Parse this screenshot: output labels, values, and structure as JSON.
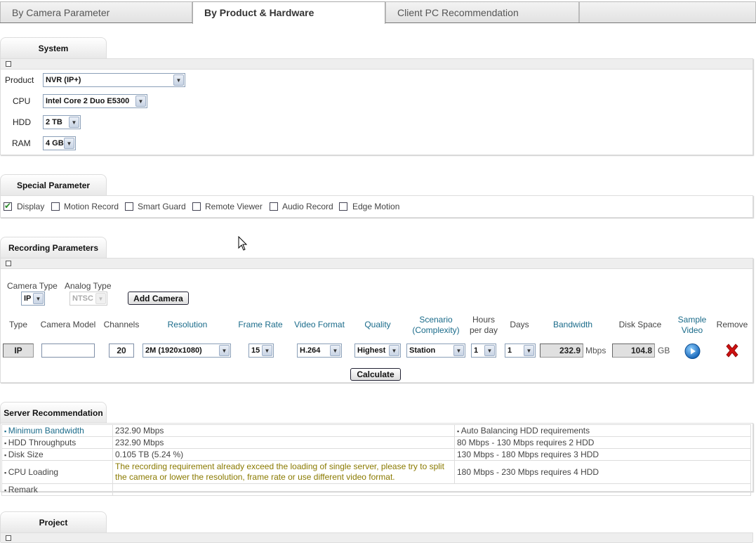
{
  "tabs": [
    "By Camera Parameter",
    "By Product & Hardware",
    "Client PC Recommendation"
  ],
  "system": {
    "title": "System",
    "product_label": "Product",
    "product_value": "NVR (IP+)",
    "cpu_label": "CPU",
    "cpu_value": "Intel Core 2 Duo E5300",
    "hdd_label": "HDD",
    "hdd_value": "2 TB",
    "ram_label": "RAM",
    "ram_value": "4 GB"
  },
  "special": {
    "title": "Special Parameter",
    "options": [
      {
        "label": "Display",
        "checked": true
      },
      {
        "label": "Motion Record",
        "checked": false
      },
      {
        "label": "Smart Guard",
        "checked": false
      },
      {
        "label": "Remote Viewer",
        "checked": false
      },
      {
        "label": "Audio Record",
        "checked": false
      },
      {
        "label": "Edge Motion",
        "checked": false
      }
    ]
  },
  "recording": {
    "title": "Recording Parameters",
    "camera_type_label": "Camera Type",
    "camera_type_value": "IP",
    "analog_type_label": "Analog Type",
    "analog_type_value": "NTSC",
    "add_camera": "Add Camera",
    "columns": {
      "type": "Type",
      "model": "Camera Model",
      "channels": "Channels",
      "resolution": "Resolution",
      "frame_rate": "Frame Rate",
      "video_format": "Video Format",
      "quality": "Quality",
      "scenario_1": "Scenario",
      "scenario_2": "(Complexity)",
      "hours_1": "Hours",
      "hours_2": "per day",
      "days": "Days",
      "bandwidth": "Bandwidth",
      "disk_space": "Disk Space",
      "sample_1": "Sample",
      "sample_2": "Video",
      "remove": "Remove"
    },
    "row": {
      "type": "IP",
      "model": "",
      "channels": "20",
      "resolution": "2M (1920x1080)",
      "frame_rate": "15",
      "video_format": "H.264",
      "quality": "Highest",
      "scenario": "Station",
      "hours": "1",
      "days": "1",
      "bandwidth": "232.9",
      "bandwidth_unit": "Mbps",
      "disk": "104.8",
      "disk_unit": "GB"
    },
    "calculate": "Calculate"
  },
  "server": {
    "title": "Server Recommendation",
    "rows": [
      {
        "label": "Minimum Bandwidth",
        "value": "232.90 Mbps",
        "right": "Auto Balancing HDD requirements"
      },
      {
        "label": "HDD Throughputs",
        "value": "232.90 Mbps",
        "right": "80 Mbps - 130 Mbps requires 2 HDD"
      },
      {
        "label": "Disk Size",
        "value": "0.105 TB (5.24 %)",
        "right": "130 Mbps - 180 Mbps requires 3 HDD"
      },
      {
        "label": "CPU Loading",
        "value": "The recording requirement already exceed the loading of single server, please try to split the camera or lower the resolution, frame rate or use different video format.",
        "right": "180 Mbps - 230 Mbps requires 4 HDD"
      },
      {
        "label": "Remark",
        "value": "",
        "right": ""
      }
    ]
  },
  "project": {
    "title": "Project"
  },
  "colors": {
    "link": "#1a6b8a",
    "warning": "#8a7a00",
    "remove": "#cc1111"
  }
}
